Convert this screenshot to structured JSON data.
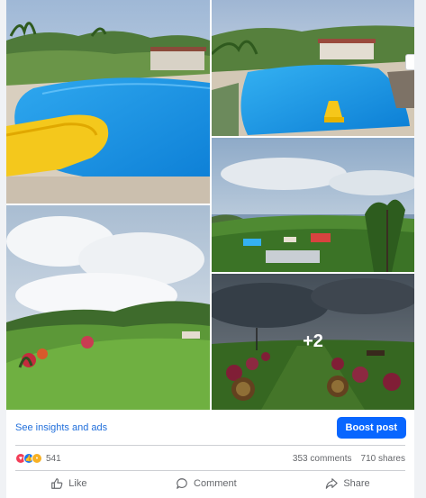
{
  "post": {
    "photos": [
      {
        "name": "pool-with-yellow-slide"
      },
      {
        "name": "pool-with-clubhouse"
      },
      {
        "name": "green-hill-under-cloudy-sky"
      },
      {
        "name": "aerial-view-resort"
      },
      {
        "name": "garden-path-with-flowers"
      }
    ],
    "more_photos_label": "+2",
    "insights_label": "See insights and ads",
    "boost_label": "Boost post",
    "reaction_count": "541",
    "comments_label": "353 comments",
    "shares_label": "710 shares",
    "like_label": "Like",
    "comment_label": "Comment",
    "share_label": "Share"
  },
  "colors": {
    "accent": "#0866ff",
    "link": "#216fdb",
    "secondary_text": "#65676b",
    "love": "#f33e58",
    "like": "#1877f2",
    "wow": "#f7b125"
  },
  "icons": [
    "heart-icon",
    "thumbs-up-icon",
    "wow-face-icon",
    "like-icon",
    "comment-icon",
    "share-icon"
  ]
}
